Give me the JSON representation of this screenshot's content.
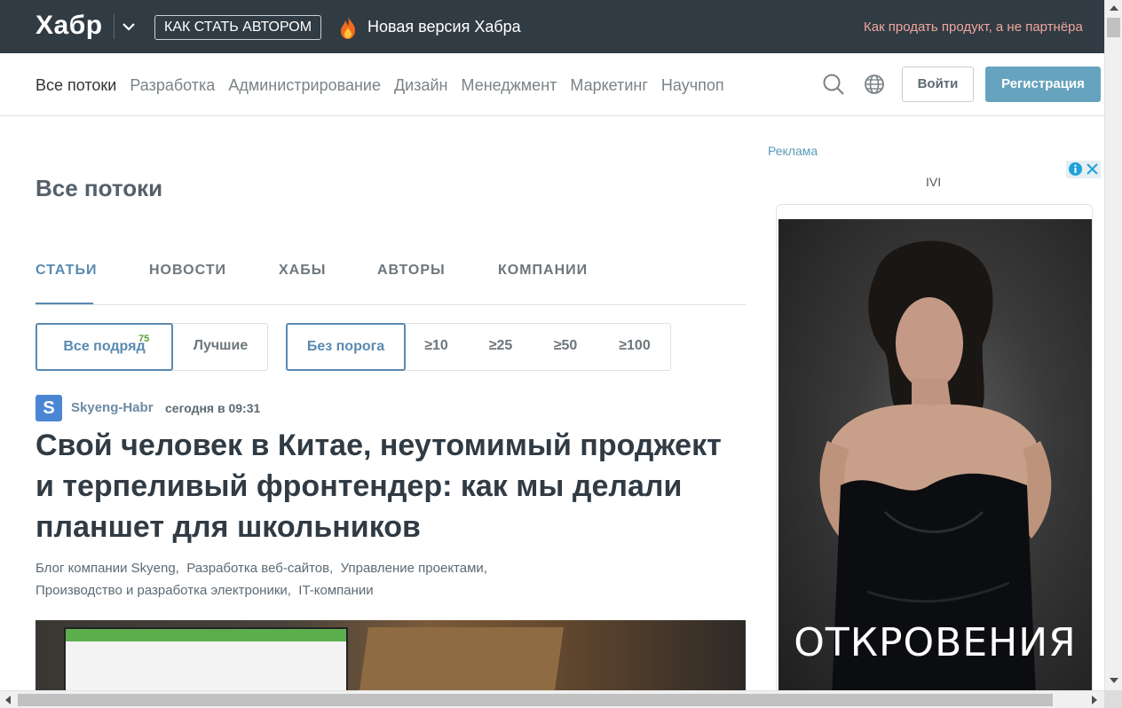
{
  "topbar": {
    "logo": "Хабр",
    "author_button": "КАК СТАТЬ АВТОРОМ",
    "new_version": "Новая версия Хабра",
    "promo": "Как продать продукт, а не партнёра"
  },
  "nav": {
    "links": [
      "Все потоки",
      "Разработка",
      "Администрирование",
      "Дизайн",
      "Менеджмент",
      "Маркетинг",
      "Научпоп"
    ],
    "login": "Войти",
    "register": "Регистрация"
  },
  "main": {
    "page_title": "Все потоки",
    "tabs": [
      "СТАТЬИ",
      "НОВОСТИ",
      "ХАБЫ",
      "АВТОРЫ",
      "КОМПАНИИ"
    ],
    "filters_sort": [
      {
        "label": "Все подряд",
        "count": "75"
      },
      {
        "label": "Лучшие"
      }
    ],
    "filters_threshold": [
      "Без порога",
      "≥10",
      "≥25",
      "≥50",
      "≥100"
    ]
  },
  "post": {
    "avatar_letter": "S",
    "author": "Skyeng-Habr",
    "time": "сегодня в 09:31",
    "title": "Свой человек в Китае, неутомимый проджект и терпеливый фронтендер: как мы делали планшет для школьников",
    "hubs": [
      "Блог компании Skyeng,",
      "Разработка веб-сайтов,",
      "Управление проектами,",
      "Производство и разработка электроники,",
      "IT-компании"
    ]
  },
  "ad": {
    "label": "Реклама",
    "brand": "IVI",
    "caption": "ОТКРОВЕНИЯ"
  },
  "colors": {
    "topbar_bg": "#303b44",
    "accent": "#5a8ab0",
    "register_bg": "#65a3be",
    "promo": "#f0a69c",
    "count": "#5b9c39"
  }
}
